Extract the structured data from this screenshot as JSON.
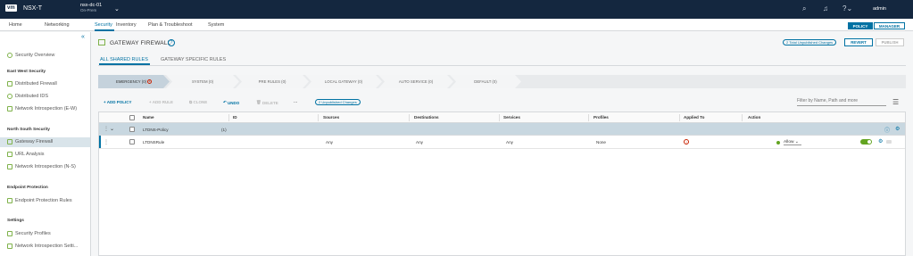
{
  "topbar": {
    "logo": "vm",
    "app_name": "NSX-T",
    "context_name": "nsx-dc-01",
    "context_sub": "On-Prem",
    "user": "admin"
  },
  "nav": {
    "tabs": [
      "Home",
      "Networking",
      "Security",
      "Inventory",
      "Plan & Troubleshoot",
      "System"
    ],
    "active": "Security",
    "mode_policy": "POLICY",
    "mode_manager": "MANAGER"
  },
  "sidebar": {
    "collapse": "«",
    "overview": "Security Overview",
    "sections": [
      {
        "title": "East West Security",
        "items": [
          "Distributed Firewall",
          "Distributed IDS",
          "Network Introspection (E-W)"
        ]
      },
      {
        "title": "North South Security",
        "items": [
          "Gateway Firewall",
          "URL Analysis",
          "Network Introspection (N-S)"
        ]
      },
      {
        "title": "Endpoint Protection",
        "items": [
          "Endpoint Protection Rules"
        ]
      },
      {
        "title": "Settings",
        "items": [
          "Security Profiles",
          "Network Introspection Setti..."
        ]
      }
    ],
    "selected": "Gateway Firewall"
  },
  "page": {
    "title": "GATEWAY FIREWALL",
    "unpublished_changes": "2 Total Unpublished Changes",
    "revert": "REVERT",
    "publish": "PUBLISH",
    "subtabs": [
      "ALL SHARED RULES",
      "GATEWAY SPECIFIC RULES"
    ],
    "categories": [
      {
        "label": "EMERGENCY (0)",
        "active": true,
        "badge": "1"
      },
      {
        "label": "SYSTEM (0)"
      },
      {
        "label": "PRE RULES (0)"
      },
      {
        "label": "LOCAL GATEWAY (0)"
      },
      {
        "label": "AUTO SERVICE (0)"
      },
      {
        "label": "DEFAULT (0)"
      }
    ]
  },
  "toolbar": {
    "add_policy": "+ ADD POLICY",
    "add_rule": "+ ADD RULE",
    "clone": "CLONE",
    "undo": "UNDO",
    "delete": "DELETE",
    "more": "···",
    "changes": "2 Unpublished Changes",
    "filter_placeholder": "Filter by Name, Path and more"
  },
  "grid": {
    "columns": [
      "Name",
      "ID",
      "Sources",
      "Destinations",
      "Services",
      "Profiles",
      "Applied To",
      "Action"
    ],
    "policy": {
      "name": "LTDNS-Policy",
      "count": "(1)"
    },
    "rule": {
      "name": "LTDNSRule",
      "sources": "Any",
      "destinations": "Any",
      "services": "Any",
      "profiles": "None",
      "action": "Allow",
      "enabled": true
    }
  }
}
